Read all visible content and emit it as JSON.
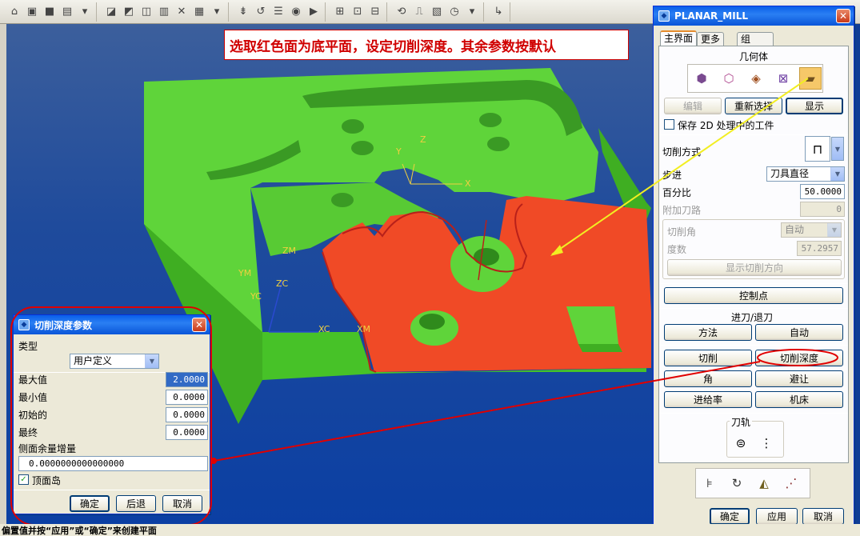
{
  "banner": {
    "text": "选取红色面为底平面，设定切削深度。其余参数按默认"
  },
  "axes": {
    "y": "Y",
    "z": "Z",
    "x": "X",
    "ym": "YM",
    "zc": "ZC",
    "yc": "YC",
    "zm": "ZM",
    "xc": "XC",
    "xm": "XM"
  },
  "statusbar": {
    "text": "偏置值并按“应用”或“确定”来创建平面"
  },
  "colors": {
    "part_green": "#5fd43a",
    "floor_red": "#f04a26",
    "annotation_red": "#e00000",
    "annotation_yellow": "#f2ee22"
  },
  "planar_mill": {
    "title": "PLANAR_MILL",
    "tabs": [
      "主界面",
      "更多",
      "组"
    ],
    "geometry_label": "几何体",
    "geometry_icons": [
      "part-geometry-icon",
      "blank-boundary-icon",
      "check-boundary-icon",
      "trim-boundary-icon",
      "floor-plane-icon"
    ],
    "edit_label": "编辑",
    "reselect_label": "重新选择",
    "display_label": "显示",
    "save_2d_label": "保存 2D 处理中的工件",
    "cut_method_label": "切削方式",
    "stepover_label": "步进",
    "stepover_value": "刀具直径",
    "percent_label": "百分比",
    "percent_value": "50.0000",
    "additional_passes_label": "附加刀路",
    "additional_passes_value": "0",
    "cut_angle_label": "切削角",
    "cut_angle_value": "自动",
    "degrees_label": "度数",
    "degrees_value": "57.2957",
    "show_cut_dir_label": "显示切削方向",
    "control_points_label": "控制点",
    "engage_retract_label": "进刀/退刀",
    "method_label": "方法",
    "auto_label": "自动",
    "cutting_label": "切削",
    "cut_depth_label": "切削深度",
    "corner_label": "角",
    "avoidance_label": "避让",
    "feedrate_label": "进给率",
    "machine_label": "机床",
    "toolpath_label": "刀轨",
    "ok_label": "确定",
    "apply_label": "应用",
    "cancel_label": "取消"
  },
  "cut_depth_dialog": {
    "title": "切削深度参数",
    "type_label": "类型",
    "type_value": "用户定义",
    "max_label": "最大值",
    "max_value": "2.0000",
    "min_label": "最小值",
    "min_value": "0.0000",
    "initial_label": "初始的",
    "initial_value": "0.0000",
    "final_label": "最终",
    "final_value": "0.0000",
    "side_stock_label": "侧面余量增量",
    "side_stock_value": "0.0000000000000000",
    "top_island_label": "顶面岛",
    "top_island_checked": true,
    "ok_label": "确定",
    "back_label": "后退",
    "cancel_label": "取消"
  }
}
